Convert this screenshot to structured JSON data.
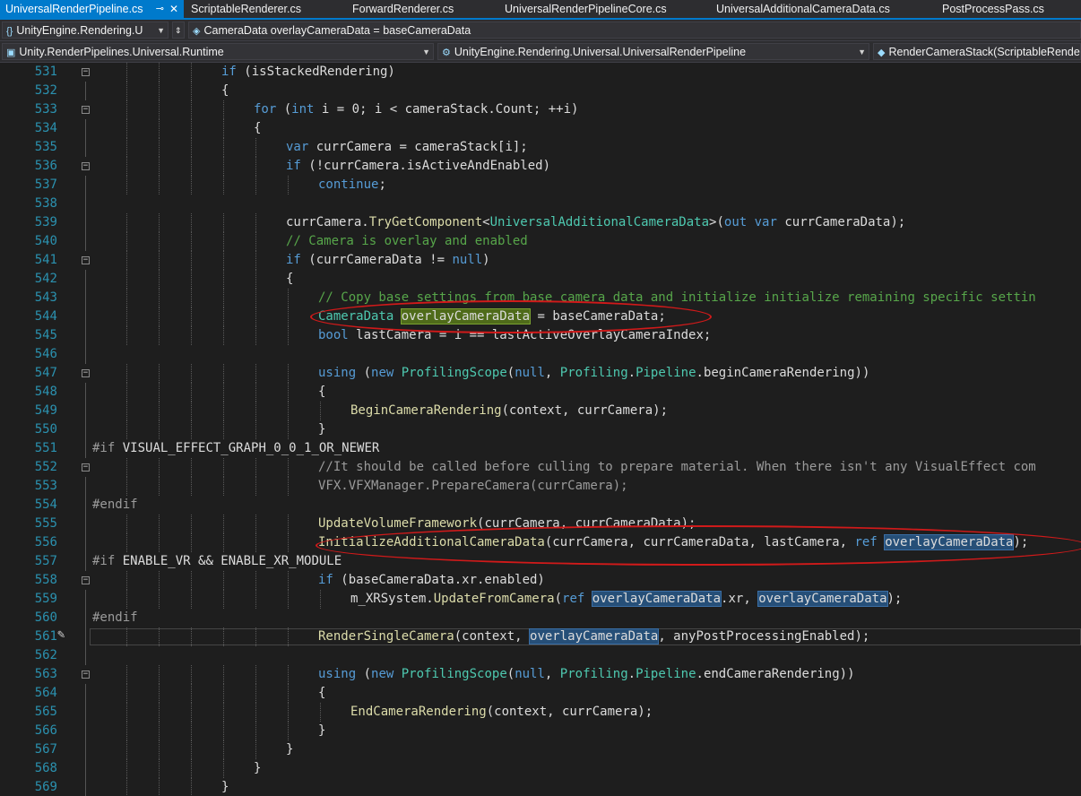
{
  "tabs": [
    {
      "label": "UniversalRenderPipeline.cs",
      "active": true,
      "pin": "⊸",
      "close": "✕"
    },
    {
      "label": "ScriptableRenderer.cs"
    },
    {
      "label": "ForwardRenderer.cs"
    },
    {
      "label": "UniversalRenderPipelineCore.cs"
    },
    {
      "label": "UniversalAdditionalCameraData.cs"
    },
    {
      "label": "PostProcessPass.cs"
    }
  ],
  "navbar": {
    "namespace_combo": "UnityEngine.Rendering.U",
    "member_combo": "CameraData overlayCameraData = baseCameraData",
    "project_combo": "Unity.RenderPipelines.Universal.Runtime",
    "class_combo": "UnityEngine.Rendering.Universal.UniversalRenderPipeline",
    "method_combo": "RenderCameraStack(ScriptableRende"
  },
  "colors": {
    "accent": "#007acc",
    "background": "#1e1e1e",
    "line_number": "#2b91af",
    "keyword": "#569cd6",
    "type": "#4ec9b0",
    "method": "#dcdcaa",
    "comment": "#57a64a",
    "annotation_circle": "#d11a1a"
  },
  "code": {
    "current_line": 561,
    "lines": [
      {
        "n": "531",
        "fold": "minus",
        "indent": 4,
        "t": [
          [
            "kw",
            "if"
          ],
          [
            "id",
            " (isStackedRendering)"
          ]
        ]
      },
      {
        "n": "532",
        "indent": 4,
        "t": [
          [
            "id",
            "{"
          ]
        ]
      },
      {
        "n": "533",
        "fold": "minus",
        "indent": 5,
        "t": [
          [
            "kw",
            "for"
          ],
          [
            "id",
            " ("
          ],
          [
            "kw",
            "int"
          ],
          [
            "id",
            " i = 0; i < cameraStack.Count; ++i)"
          ]
        ]
      },
      {
        "n": "534",
        "indent": 5,
        "t": [
          [
            "id",
            "{"
          ]
        ]
      },
      {
        "n": "535",
        "indent": 6,
        "t": [
          [
            "kw",
            "var"
          ],
          [
            "id",
            " currCamera = cameraStack[i];"
          ]
        ]
      },
      {
        "n": "536",
        "fold": "minus",
        "indent": 6,
        "t": [
          [
            "kw",
            "if"
          ],
          [
            "id",
            " (!currCamera.isActiveAndEnabled)"
          ]
        ]
      },
      {
        "n": "537",
        "indent": 7,
        "t": [
          [
            "kw",
            "continue"
          ],
          [
            "id",
            ";"
          ]
        ]
      },
      {
        "n": "538",
        "indent": 0,
        "t": []
      },
      {
        "n": "539",
        "indent": 6,
        "t": [
          [
            "id",
            "currCamera."
          ],
          [
            "mt",
            "TryGetComponent"
          ],
          [
            "id",
            "<"
          ],
          [
            "ty",
            "UniversalAdditionalCameraData"
          ],
          [
            "id",
            ">("
          ],
          [
            "kw",
            "out"
          ],
          [
            "id",
            " "
          ],
          [
            "kw",
            "var"
          ],
          [
            "id",
            " currCameraData);"
          ]
        ]
      },
      {
        "n": "540",
        "indent": 6,
        "t": [
          [
            "cm",
            "// Camera is overlay and enabled"
          ]
        ]
      },
      {
        "n": "541",
        "fold": "minus",
        "indent": 6,
        "t": [
          [
            "kw",
            "if"
          ],
          [
            "id",
            " (currCameraData != "
          ],
          [
            "kw",
            "null"
          ],
          [
            "id",
            ")"
          ]
        ]
      },
      {
        "n": "542",
        "indent": 6,
        "t": [
          [
            "id",
            "{"
          ]
        ]
      },
      {
        "n": "543",
        "indent": 7,
        "t": [
          [
            "cm",
            "// Copy base settings from base camera data and initialize initialize remaining specific settin"
          ]
        ]
      },
      {
        "n": "544",
        "indent": 7,
        "t": [
          [
            "ty",
            "CameraData"
          ],
          [
            "id",
            " "
          ],
          [
            "hlg",
            "overlayCameraData"
          ],
          [
            "id",
            " = baseCameraData;"
          ]
        ]
      },
      {
        "n": "545",
        "indent": 7,
        "t": [
          [
            "kw",
            "bool"
          ],
          [
            "id",
            " lastCamera = i == lastActiveOverlayCameraIndex;"
          ]
        ]
      },
      {
        "n": "546",
        "indent": 0,
        "t": []
      },
      {
        "n": "547",
        "fold": "minus",
        "indent": 7,
        "t": [
          [
            "kw",
            "using"
          ],
          [
            "id",
            " ("
          ],
          [
            "kw",
            "new"
          ],
          [
            "id",
            " "
          ],
          [
            "ty",
            "ProfilingScope"
          ],
          [
            "id",
            "("
          ],
          [
            "kw",
            "null"
          ],
          [
            "id",
            ", "
          ],
          [
            "ty",
            "Profiling"
          ],
          [
            "id",
            "."
          ],
          [
            "ty",
            "Pipeline"
          ],
          [
            "id",
            ".beginCameraRendering))"
          ]
        ]
      },
      {
        "n": "548",
        "indent": 7,
        "t": [
          [
            "id",
            "{"
          ]
        ]
      },
      {
        "n": "549",
        "indent": 8,
        "t": [
          [
            "mt",
            "BeginCameraRendering"
          ],
          [
            "id",
            "(context, currCamera);"
          ]
        ]
      },
      {
        "n": "550",
        "indent": 7,
        "t": [
          [
            "id",
            "}"
          ]
        ]
      },
      {
        "n": "551",
        "indent": 0,
        "t": [
          [
            "pp",
            "#if"
          ],
          [
            "id",
            " VISUAL_EFFECT_GRAPH_0_0_1_OR_NEWER"
          ]
        ]
      },
      {
        "n": "552",
        "fold": "minus",
        "indent": 7,
        "t": [
          [
            "gr",
            "//It should be called before culling to prepare material. When there isn't any VisualEffect com"
          ]
        ]
      },
      {
        "n": "553",
        "indent": 7,
        "t": [
          [
            "gr",
            "VFX.VFXManager.PrepareCamera(currCamera);"
          ]
        ]
      },
      {
        "n": "554",
        "indent": 0,
        "t": [
          [
            "pp",
            "#endif"
          ]
        ]
      },
      {
        "n": "555",
        "indent": 7,
        "t": [
          [
            "mt",
            "UpdateVolumeFramework"
          ],
          [
            "id",
            "(currCamera, currCameraData);"
          ]
        ]
      },
      {
        "n": "556",
        "indent": 7,
        "t": [
          [
            "mt",
            "InitializeAdditionalCameraData"
          ],
          [
            "id",
            "(currCamera, currCameraData, lastCamera, "
          ],
          [
            "kw",
            "ref"
          ],
          [
            "id",
            " "
          ],
          [
            "hl",
            "overlayCameraData"
          ],
          [
            "id",
            ");"
          ]
        ]
      },
      {
        "n": "557",
        "indent": 0,
        "t": [
          [
            "pp",
            "#if"
          ],
          [
            "id",
            " ENABLE_VR && ENABLE_XR_MODULE"
          ]
        ]
      },
      {
        "n": "558",
        "fold": "minus",
        "indent": 7,
        "t": [
          [
            "kw",
            "if"
          ],
          [
            "id",
            " (baseCameraData.xr.enabled)"
          ]
        ]
      },
      {
        "n": "559",
        "indent": 8,
        "t": [
          [
            "id",
            "m_XRSystem."
          ],
          [
            "mt",
            "UpdateFromCamera"
          ],
          [
            "id",
            "("
          ],
          [
            "kw",
            "ref"
          ],
          [
            "id",
            " "
          ],
          [
            "hl",
            "overlayCameraData"
          ],
          [
            "id",
            ".xr, "
          ],
          [
            "hl",
            "overlayCameraData"
          ],
          [
            "id",
            ");"
          ]
        ]
      },
      {
        "n": "560",
        "indent": 0,
        "t": [
          [
            "pp",
            "#endif"
          ]
        ]
      },
      {
        "n": "561",
        "indent": 7,
        "t": [
          [
            "mt",
            "RenderSingleCamera"
          ],
          [
            "id",
            "(context, "
          ],
          [
            "hl",
            "overlayCameraData"
          ],
          [
            "id",
            ", anyPostProcessingEnabled);"
          ]
        ]
      },
      {
        "n": "562",
        "indent": 0,
        "t": []
      },
      {
        "n": "563",
        "fold": "minus",
        "indent": 7,
        "t": [
          [
            "kw",
            "using"
          ],
          [
            "id",
            " ("
          ],
          [
            "kw",
            "new"
          ],
          [
            "id",
            " "
          ],
          [
            "ty",
            "ProfilingScope"
          ],
          [
            "id",
            "("
          ],
          [
            "kw",
            "null"
          ],
          [
            "id",
            ", "
          ],
          [
            "ty",
            "Profiling"
          ],
          [
            "id",
            "."
          ],
          [
            "ty",
            "Pipeline"
          ],
          [
            "id",
            ".endCameraRendering))"
          ]
        ]
      },
      {
        "n": "564",
        "indent": 7,
        "t": [
          [
            "id",
            "{"
          ]
        ]
      },
      {
        "n": "565",
        "indent": 8,
        "t": [
          [
            "mt",
            "EndCameraRendering"
          ],
          [
            "id",
            "(context, currCamera);"
          ]
        ]
      },
      {
        "n": "566",
        "indent": 7,
        "t": [
          [
            "id",
            "}"
          ]
        ]
      },
      {
        "n": "567",
        "indent": 6,
        "t": [
          [
            "id",
            "}"
          ]
        ]
      },
      {
        "n": "568",
        "indent": 5,
        "t": [
          [
            "id",
            "}"
          ]
        ]
      },
      {
        "n": "569",
        "indent": 4,
        "t": [
          [
            "id",
            "}"
          ]
        ]
      }
    ]
  }
}
